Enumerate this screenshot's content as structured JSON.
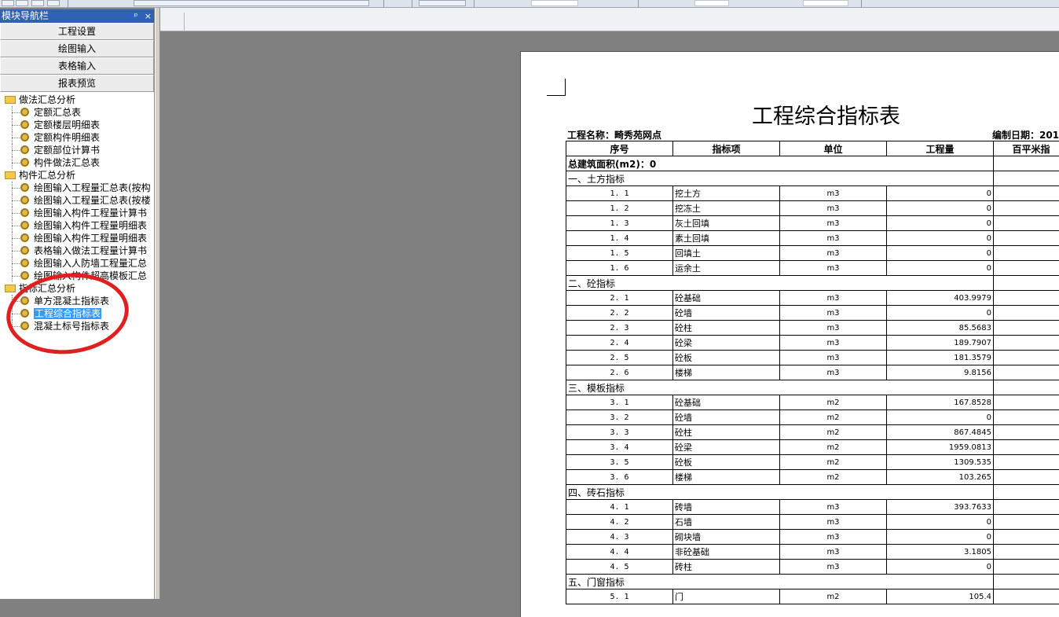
{
  "panel": {
    "title": "模块导航栏",
    "pin_glyph": "ᵖ",
    "close_glyph": "×"
  },
  "nav_buttons": [
    "工程设置",
    "绘图输入",
    "表格输入",
    "报表预览"
  ],
  "tree": [
    {
      "type": "group",
      "label": "做法汇总分析"
    },
    {
      "type": "leaf",
      "label": "定额汇总表"
    },
    {
      "type": "leaf",
      "label": "定额楼层明细表"
    },
    {
      "type": "leaf",
      "label": "定额构件明细表"
    },
    {
      "type": "leaf",
      "label": "定额部位计算书"
    },
    {
      "type": "leaf",
      "label": "构件做法汇总表"
    },
    {
      "type": "group",
      "label": "构件汇总分析"
    },
    {
      "type": "leaf",
      "label": "绘图输入工程量汇总表(按构"
    },
    {
      "type": "leaf",
      "label": "绘图输入工程量汇总表(按楼"
    },
    {
      "type": "leaf",
      "label": "绘图输入构件工程量计算书"
    },
    {
      "type": "leaf",
      "label": "绘图输入构件工程量明细表"
    },
    {
      "type": "leaf",
      "label": "绘图输入构件工程量明细表"
    },
    {
      "type": "leaf",
      "label": "表格输入做法工程量计算书"
    },
    {
      "type": "leaf",
      "label": "绘图输入人防墙工程量汇总"
    },
    {
      "type": "leaf",
      "label": "绘图输入构件超高模板汇总"
    },
    {
      "type": "group",
      "label": "指标汇总分析"
    },
    {
      "type": "leaf",
      "label": "单方混凝土指标表"
    },
    {
      "type": "leaf",
      "label": "工程综合指标表",
      "selected": true
    },
    {
      "type": "leaf",
      "label": "混凝土标号指标表"
    }
  ],
  "report": {
    "title": "工程综合指标表",
    "project_line": "工程名称：畸秀苑网点",
    "date_line": "编制日期：201",
    "headers": [
      "序号",
      "指标项",
      "单位",
      "工程量",
      "百平米指"
    ],
    "total_area": "总建筑面积(m2)：0",
    "rows": [
      {
        "section": "一、土方指标"
      },
      {
        "seq": "1. 1",
        "item": "挖土方",
        "unit": "m3",
        "qty": "0"
      },
      {
        "seq": "1. 2",
        "item": "挖冻土",
        "unit": "m3",
        "qty": "0"
      },
      {
        "seq": "1. 3",
        "item": "灰土回填",
        "unit": "m3",
        "qty": "0"
      },
      {
        "seq": "1. 4",
        "item": "素土回填",
        "unit": "m3",
        "qty": "0"
      },
      {
        "seq": "1. 5",
        "item": "回填土",
        "unit": "m3",
        "qty": "0"
      },
      {
        "seq": "1. 6",
        "item": "运余土",
        "unit": "m3",
        "qty": "0"
      },
      {
        "section": "二、砼指标"
      },
      {
        "seq": "2. 1",
        "item": "砼基础",
        "unit": "m3",
        "qty": "403.9979"
      },
      {
        "seq": "2. 2",
        "item": "砼墙",
        "unit": "m3",
        "qty": "0"
      },
      {
        "seq": "2. 3",
        "item": "砼柱",
        "unit": "m3",
        "qty": "85.5683"
      },
      {
        "seq": "2. 4",
        "item": "砼梁",
        "unit": "m3",
        "qty": "189.7907"
      },
      {
        "seq": "2. 5",
        "item": "砼板",
        "unit": "m3",
        "qty": "181.3579"
      },
      {
        "seq": "2. 6",
        "item": "楼梯",
        "unit": "m3",
        "qty": "9.8156"
      },
      {
        "section": "三、模板指标"
      },
      {
        "seq": "3. 1",
        "item": "砼基础",
        "unit": "m2",
        "qty": "167.8528"
      },
      {
        "seq": "3. 2",
        "item": "砼墙",
        "unit": "m2",
        "qty": "0"
      },
      {
        "seq": "3. 3",
        "item": "砼柱",
        "unit": "m2",
        "qty": "867.4845"
      },
      {
        "seq": "3. 4",
        "item": "砼梁",
        "unit": "m2",
        "qty": "1959.0813"
      },
      {
        "seq": "3. 5",
        "item": "砼板",
        "unit": "m2",
        "qty": "1309.535"
      },
      {
        "seq": "3. 6",
        "item": "楼梯",
        "unit": "m2",
        "qty": "103.265"
      },
      {
        "section": "四、砖石指标"
      },
      {
        "seq": "4. 1",
        "item": "砖墙",
        "unit": "m3",
        "qty": "393.7633"
      },
      {
        "seq": "4. 2",
        "item": "石墙",
        "unit": "m3",
        "qty": "0"
      },
      {
        "seq": "4. 3",
        "item": "砌块墙",
        "unit": "m3",
        "qty": "0"
      },
      {
        "seq": "4. 4",
        "item": "非砼基础",
        "unit": "m3",
        "qty": "3.1805"
      },
      {
        "seq": "4. 5",
        "item": "砖柱",
        "unit": "m3",
        "qty": "0"
      },
      {
        "section": "五、门窗指标"
      },
      {
        "seq": "5. 1",
        "item": "门",
        "unit": "m2",
        "qty": "105.4"
      }
    ]
  }
}
